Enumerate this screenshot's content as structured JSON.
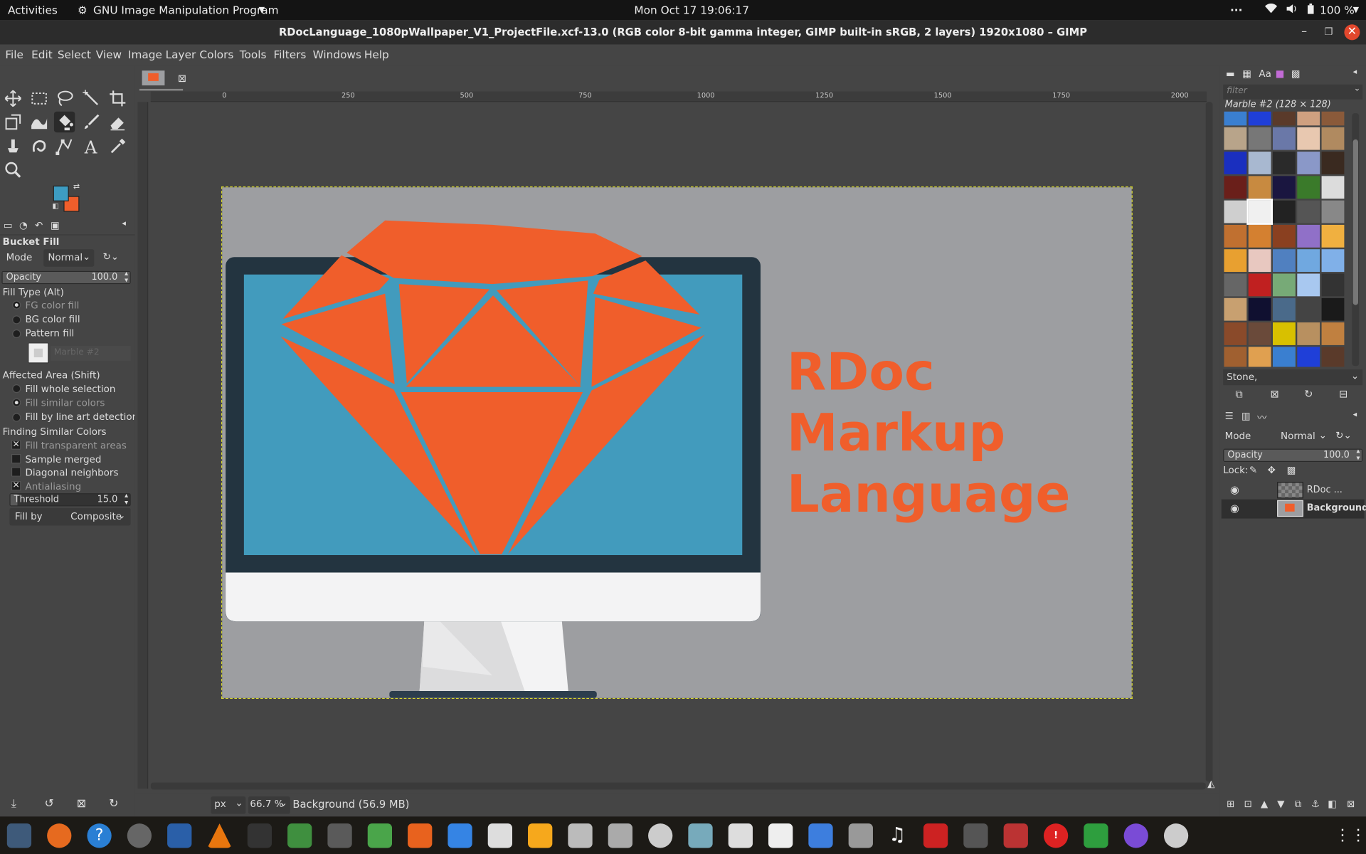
{
  "topbar": {
    "activities": "Activities",
    "app_name": "GNU Image Manipulation Program",
    "clock": "Mon Oct 17  19:06:17",
    "battery": "100 %"
  },
  "window": {
    "title": "RDocLanguage_1080pWallpaper_V1_ProjectFile.xcf-13.0 (RGB color 8-bit gamma integer, GIMP built-in sRGB, 2 layers) 1920x1080 – GIMP"
  },
  "menu": [
    "File",
    "Edit",
    "Select",
    "View",
    "Image",
    "Layer",
    "Colors",
    "Tools",
    "Filters",
    "Windows",
    "Help"
  ],
  "colors": {
    "fg": "#3d9cc2",
    "bg": "#f05e2b"
  },
  "tool_options": {
    "title": "Bucket Fill",
    "mode_label": "Mode",
    "mode_value": "Normal",
    "opacity_label": "Opacity",
    "opacity_value": "100.0",
    "fill_type_label": "Fill Type  (Alt)",
    "fill_types": [
      "FG color fill",
      "BG color fill",
      "Pattern fill"
    ],
    "pattern_name": "Marble #2",
    "affected_label": "Affected Area  (Shift)",
    "affected_options": [
      "Fill whole selection",
      "Fill similar colors",
      "Fill by line art detection"
    ],
    "finding_label": "Finding Similar Colors",
    "finding_options": [
      "Fill transparent areas",
      "Sample merged",
      "Diagonal neighbors",
      "Antialiasing"
    ],
    "threshold_label": "Threshold",
    "threshold_value": "15.0",
    "fillby_label": "Fill by",
    "fillby_value": "Composite"
  },
  "ruler_ticks": [
    "0",
    "250",
    "500",
    "750",
    "1000",
    "1250",
    "1500",
    "1750",
    "2000"
  ],
  "canvas_text": [
    "RDoc",
    "Markup",
    "Language"
  ],
  "status": {
    "unit": "px",
    "zoom": "66.7 %",
    "info": "Background (56.9 MB)"
  },
  "patterns": {
    "filter_placeholder": "filter",
    "selected": "Marble #2 (128 × 128)",
    "tag": "Stone,"
  },
  "layers": {
    "mode_label": "Mode",
    "mode_value": "Normal",
    "opacity_label": "Opacity",
    "opacity_value": "100.0",
    "lock_label": "Lock:",
    "items": [
      "RDoc ...",
      "Background"
    ]
  }
}
